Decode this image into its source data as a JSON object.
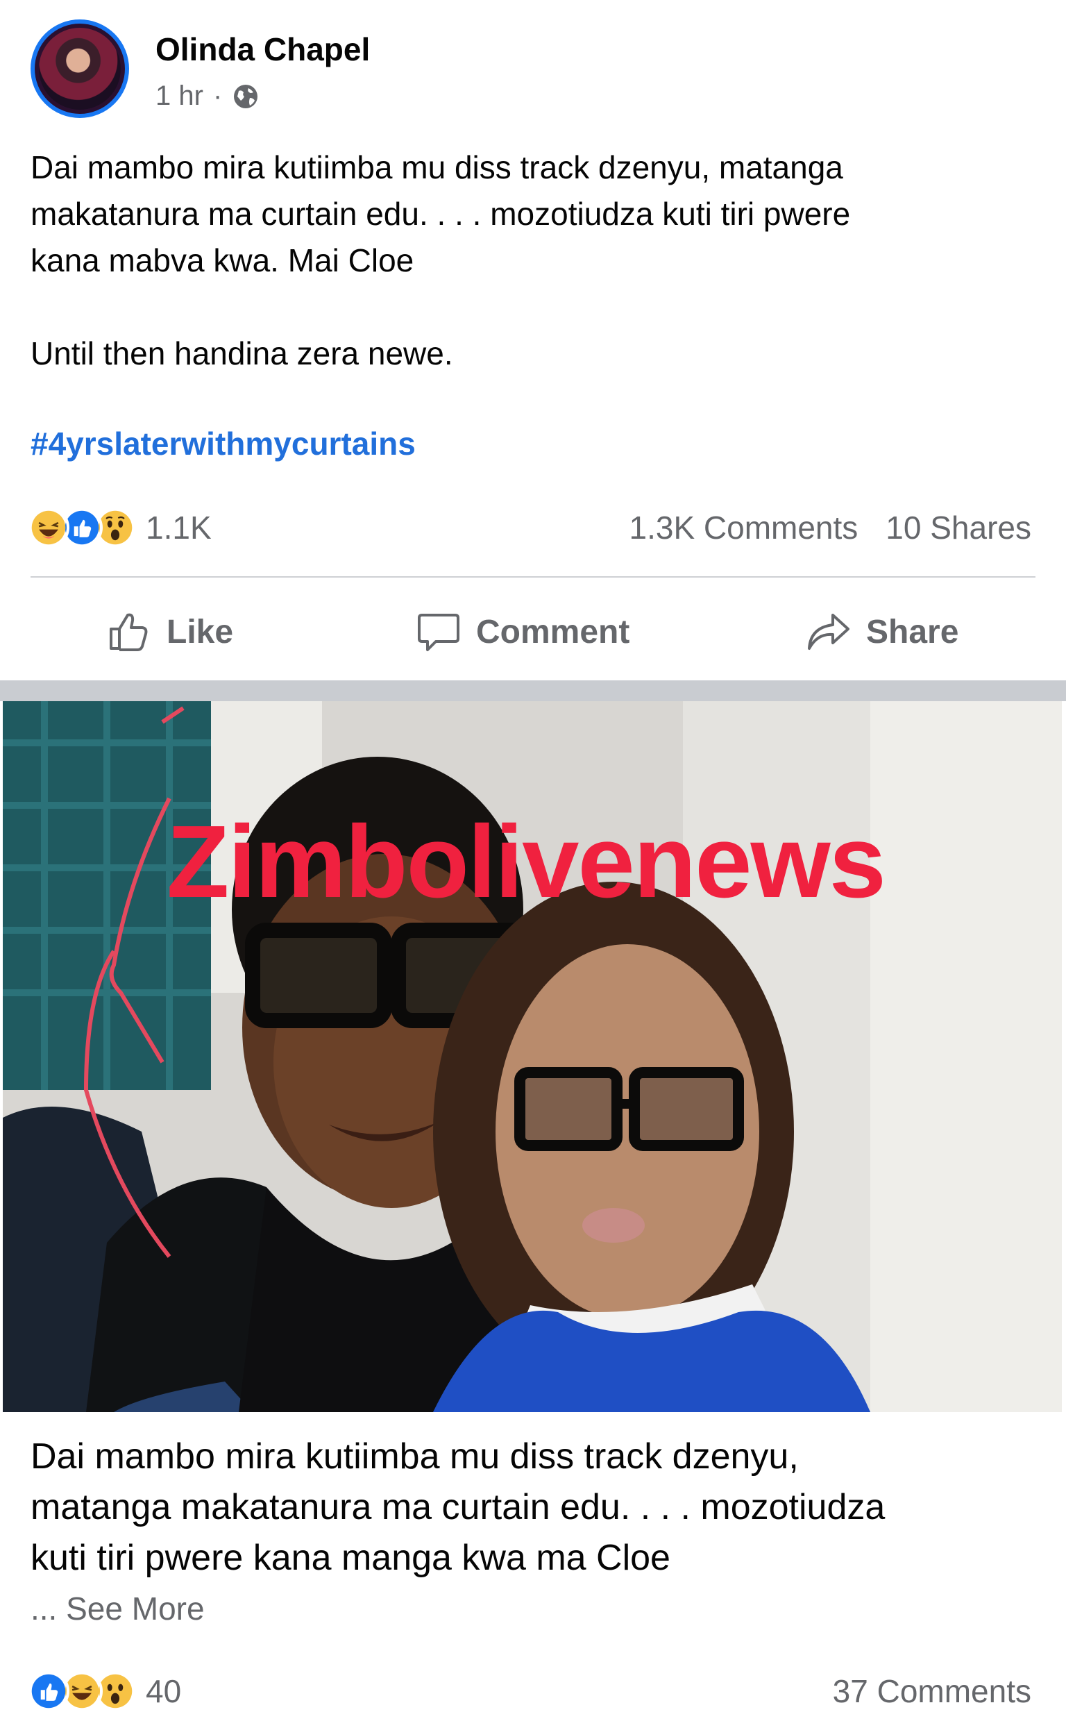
{
  "post": {
    "author": "Olinda Chapel",
    "time": "1 hr",
    "dot": "·",
    "privacy_icon": "globe-icon",
    "body_line1": "Dai mambo mira kutiimba mu diss track dzenyu, matanga",
    "body_line2": "makatanura ma curtain edu. . . . mozotiudza kuti tiri pwere",
    "body_line3": "kana mabva kwa. Mai Cloe",
    "body_line4": "Until then handina zera newe.",
    "hashtag": "#4yrslaterwithmycurtains",
    "reaction_count": "1.1K",
    "comments": "1.3K Comments",
    "shares": "10 Shares",
    "reaction_icons": [
      "haha-icon",
      "like-icon",
      "wow-icon"
    ]
  },
  "actions": {
    "like": "Like",
    "comment": "Comment",
    "share": "Share"
  },
  "shared": {
    "watermark": "Zimbolivenews",
    "caption_line1": "Dai mambo mira kutiimba mu diss track dzenyu,",
    "caption_line2": "matanga makatanura ma curtain edu. . . . mozotiudza",
    "caption_line3": "kuti tiri pwere kana manga kwa ma Cloe",
    "see_more": "... See More",
    "reaction_count": "40",
    "comments": "37 Comments",
    "reaction_icons": [
      "like-icon",
      "haha-icon",
      "wow-icon"
    ]
  },
  "colors": {
    "accent": "#1877f2",
    "hashtag": "#216fdb",
    "secondary_text": "#65676b",
    "watermark": "#f0213f"
  }
}
